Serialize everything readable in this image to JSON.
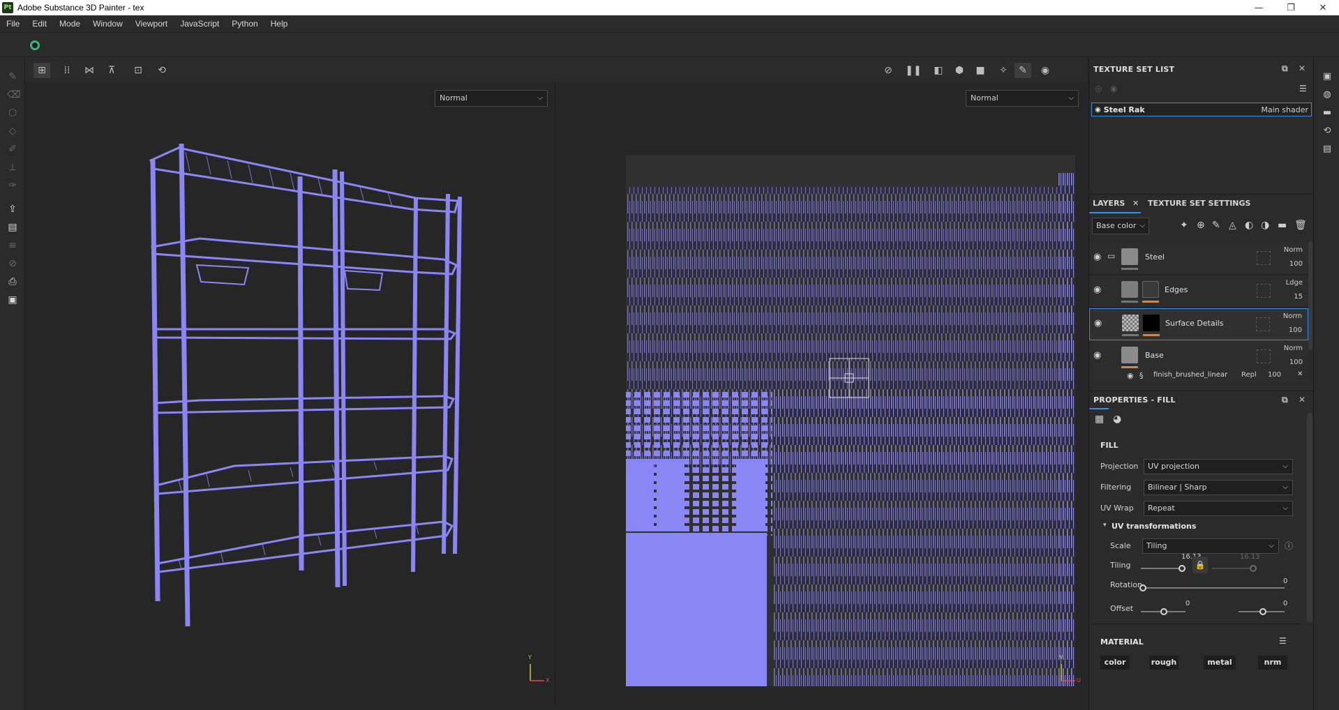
{
  "window": {
    "title": "Adobe Substance 3D Painter - tex",
    "logo": "Pt",
    "controls": [
      "—",
      "❐",
      "✕"
    ]
  },
  "menu": [
    "File",
    "Edit",
    "Mode",
    "Window",
    "Viewport",
    "JavaScript",
    "Python",
    "Help"
  ],
  "viewport_left": {
    "blend_mode": "Normal",
    "axis_y": "Y",
    "axis_x": "X"
  },
  "viewport_right": {
    "blend_mode": "Normal",
    "axis_y": "V",
    "axis_x": "U"
  },
  "texture_set_list": {
    "title": "TEXTURE SET LIST",
    "item": {
      "name": "Steel Rak",
      "shader": "Main shader"
    }
  },
  "layers_panel": {
    "tab_layers": "LAYERS",
    "tab_settings": "TEXTURE SET SETTINGS",
    "channel": "Base color",
    "layers": [
      {
        "name": "Steel",
        "blend": "Norm",
        "opacity": "100"
      },
      {
        "name": "Edges",
        "blend": "Ldge",
        "opacity": "15"
      },
      {
        "name": "Surface Details",
        "blend": "Norm",
        "opacity": "100"
      },
      {
        "name": "Base",
        "blend": "Norm",
        "opacity": "100"
      }
    ],
    "effect": {
      "name": "finish_brushed_linear",
      "blend": "Repl",
      "opacity": "100"
    }
  },
  "properties": {
    "title": "PROPERTIES - FILL",
    "section": "FILL",
    "projection_label": "Projection",
    "projection": "UV projection",
    "filtering_label": "Filtering",
    "filtering": "Bilinear | Sharp",
    "uvwrap_label": "UV Wrap",
    "uvwrap": "Repeat",
    "uv_transform_title": "UV transformations",
    "scale_label": "Scale",
    "scale": "Tiling",
    "tiling_label": "Tiling",
    "tiling_u": "16.13",
    "tiling_v": "16.13",
    "rotation_label": "Rotation",
    "rotation": "0",
    "offset_label": "Offset",
    "offset_u": "0",
    "offset_v": "0",
    "material_title": "MATERIAL",
    "channels": [
      "color",
      "rough",
      "metal",
      "nrm"
    ]
  },
  "colors": {
    "accent": "#3a8ee6",
    "wire": "#8a86f5",
    "orange": "#e8822a"
  }
}
